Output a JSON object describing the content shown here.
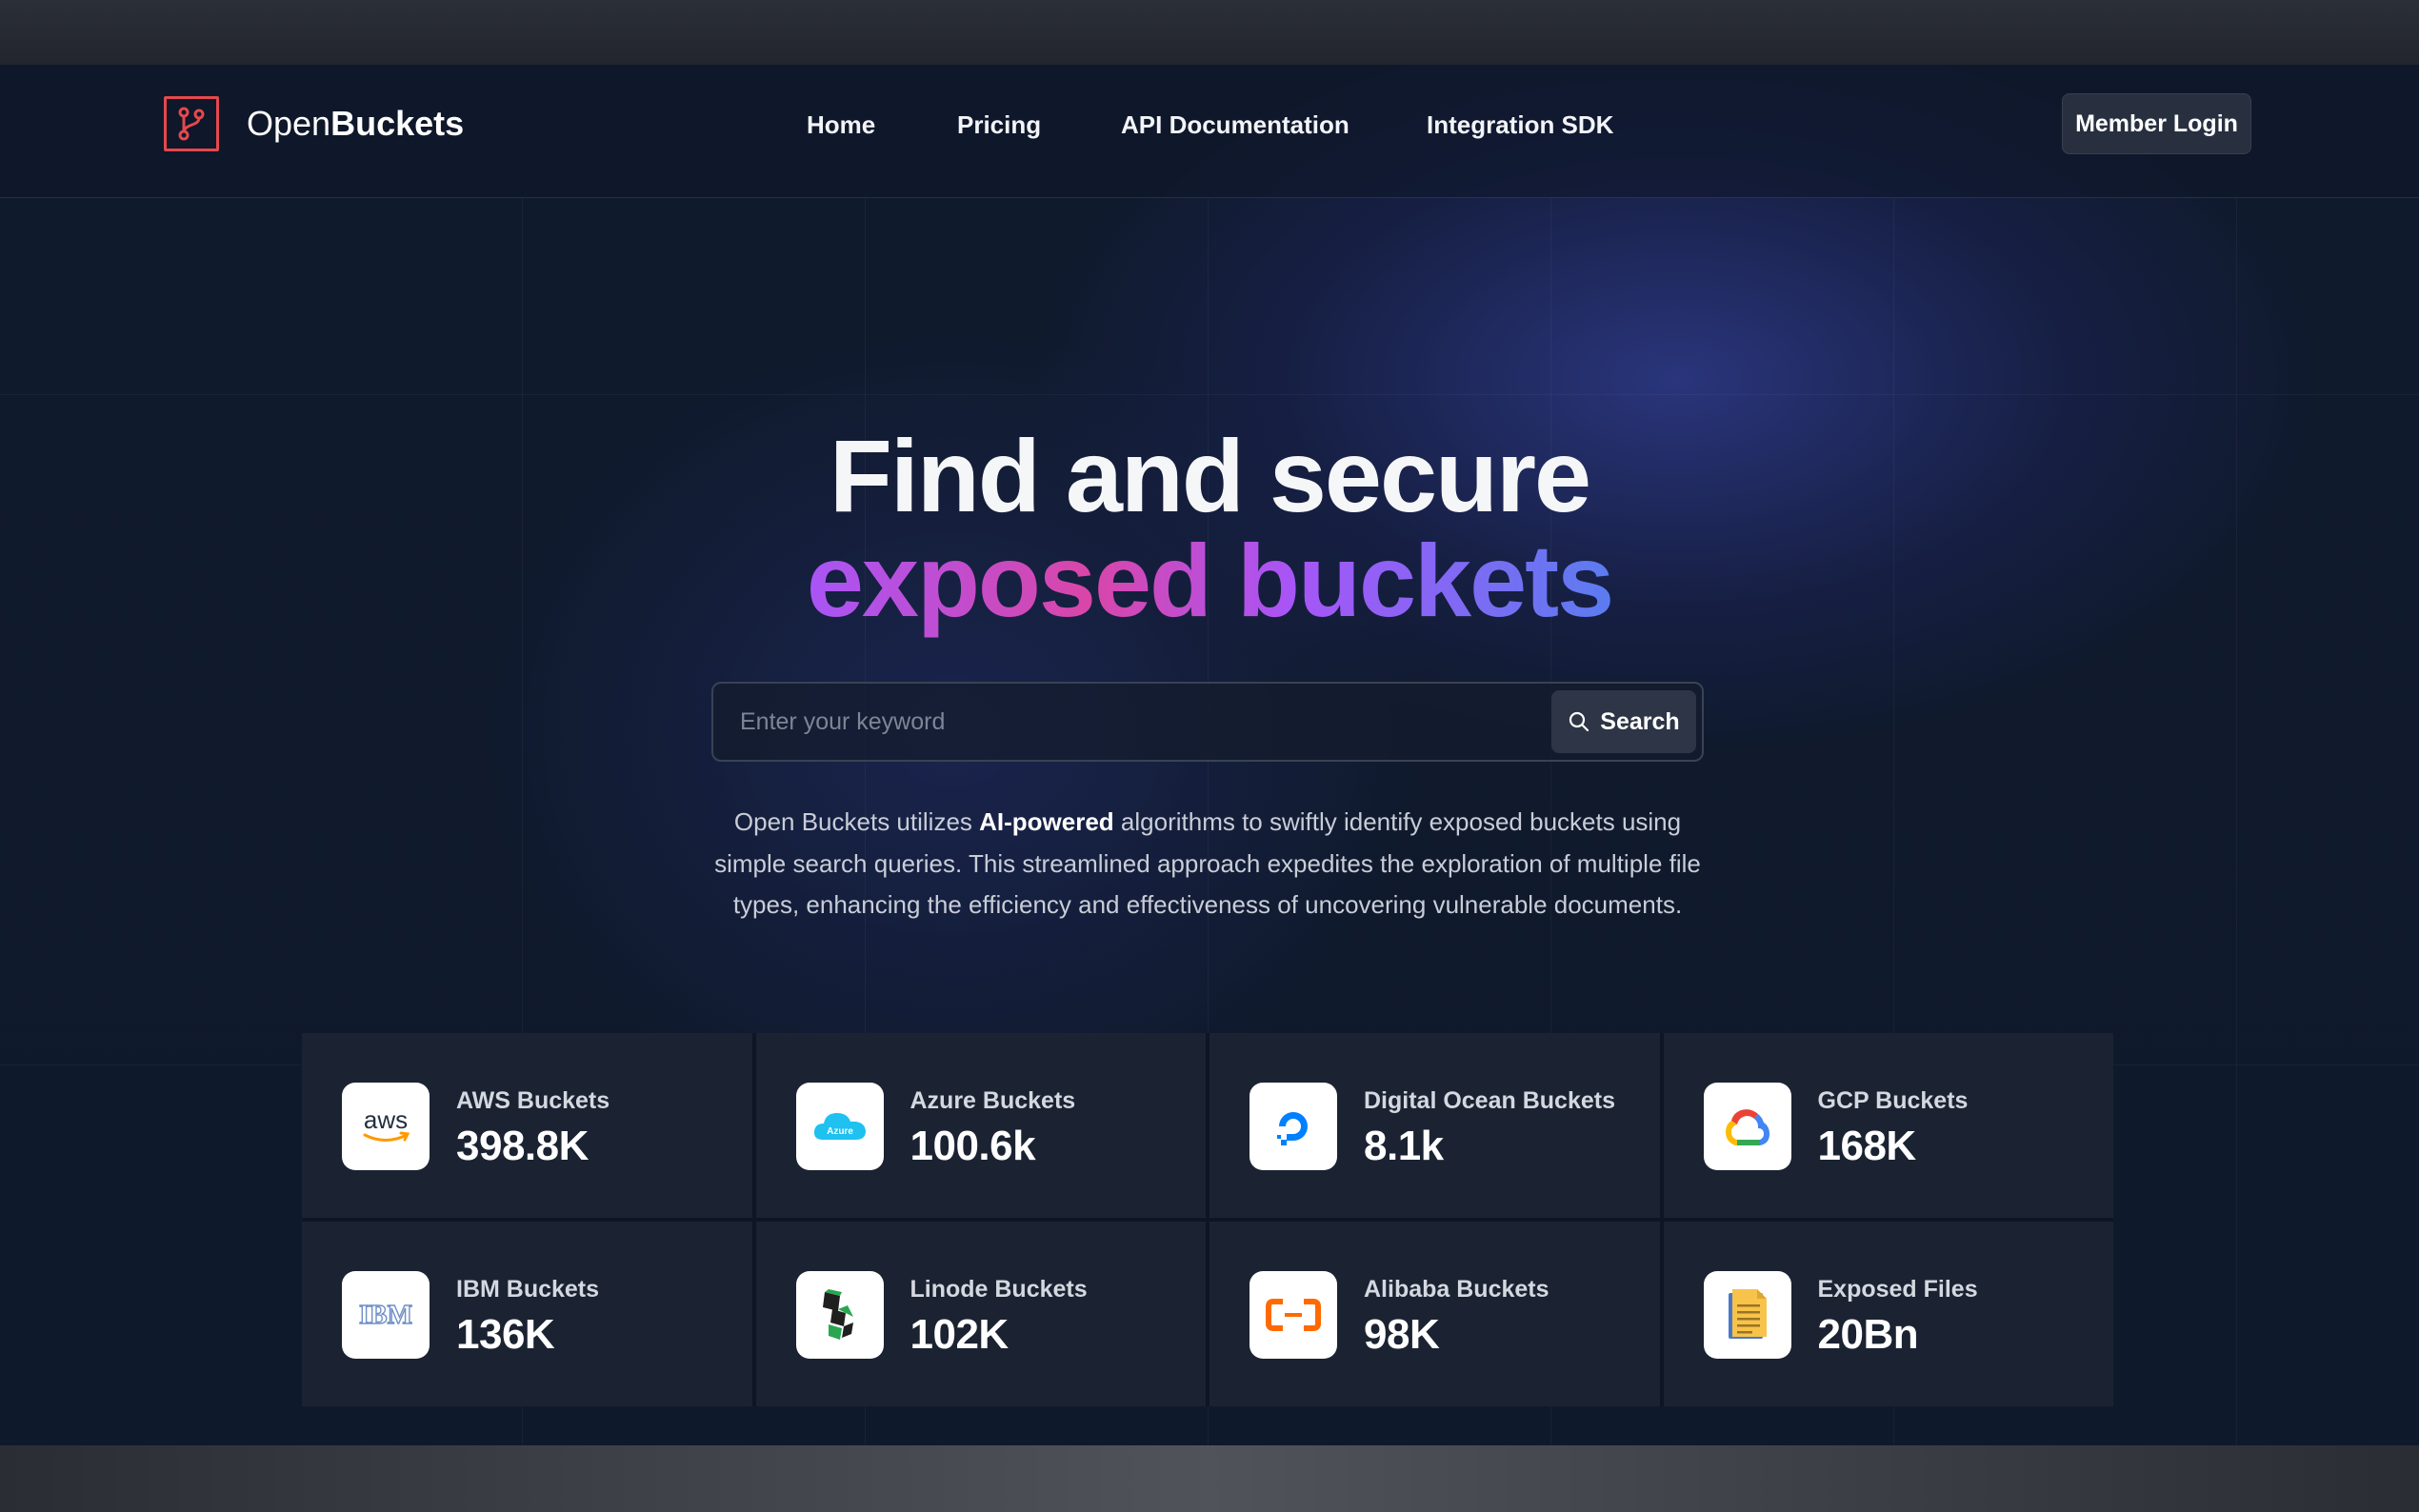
{
  "brand": {
    "name_light": "Open",
    "name_bold": "Buckets",
    "logo_color": "#e5484d"
  },
  "nav": {
    "links": [
      "Home",
      "Pricing",
      "API Documentation",
      "Integration SDK"
    ],
    "login_label": "Member Login"
  },
  "hero": {
    "line1": "Find and secure",
    "line2": "exposed buckets",
    "gradient_colors": [
      "#a855f7",
      "#d946a8",
      "#5b7cf0"
    ]
  },
  "search": {
    "placeholder": "Enter your keyword",
    "value": "",
    "button_label": "Search"
  },
  "description": {
    "prefix": "Open Buckets utilizes ",
    "bold": "AI-powered",
    "suffix": " algorithms to swiftly identify exposed buckets using simple search queries. This streamlined approach expedites the exploration of multiple file types, enhancing the efficiency and effectiveness of uncovering vulnerable documents."
  },
  "stats": [
    {
      "label": "AWS Buckets",
      "value": "398.8K",
      "icon": "aws-icon"
    },
    {
      "label": "Azure Buckets",
      "value": "100.6k",
      "icon": "azure-icon"
    },
    {
      "label": "Digital Ocean Buckets",
      "value": "8.1k",
      "icon": "digital-ocean-icon"
    },
    {
      "label": "GCP Buckets",
      "value": "168K",
      "icon": "gcp-icon"
    },
    {
      "label": "IBM Buckets",
      "value": "136K",
      "icon": "ibm-icon"
    },
    {
      "label": "Linode Buckets",
      "value": "102K",
      "icon": "linode-icon"
    },
    {
      "label": "Alibaba Buckets",
      "value": "98K",
      "icon": "alibaba-icon"
    },
    {
      "label": "Exposed Files",
      "value": "20Bn",
      "icon": "document-icon"
    }
  ],
  "icon_text": {
    "aws": "aws",
    "azure": "Azure",
    "ibm": "IBM"
  }
}
